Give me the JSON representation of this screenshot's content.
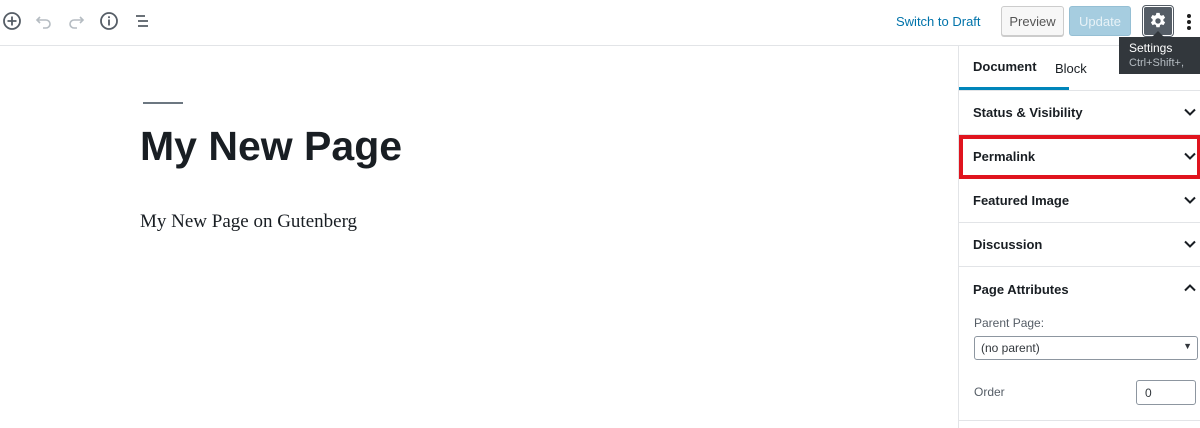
{
  "toolbar": {
    "icons": [
      "add-block-icon",
      "undo-icon",
      "redo-icon",
      "info-icon",
      "list-view-icon"
    ],
    "switch_to_draft": "Switch to Draft",
    "preview": "Preview",
    "update": "Update",
    "settings_icon": "gear-icon",
    "more_icon": "more-vertical-icon"
  },
  "tooltip": {
    "title": "Settings",
    "shortcut": "Ctrl+Shift+,"
  },
  "editor": {
    "title": "My New Page",
    "paragraph": "My New Page on Gutenberg"
  },
  "sidebar": {
    "tabs": [
      {
        "label": "Document",
        "active": true
      },
      {
        "label": "Block",
        "active": false
      }
    ],
    "panels": [
      {
        "label": "Status & Visibility",
        "expanded": false
      },
      {
        "label": "Permalink",
        "expanded": false,
        "highlighted": true
      },
      {
        "label": "Featured Image",
        "expanded": false
      },
      {
        "label": "Discussion",
        "expanded": false
      },
      {
        "label": "Page Attributes",
        "expanded": true
      }
    ],
    "page_attributes": {
      "parent_label": "Parent Page:",
      "parent_value": "(no parent)",
      "order_label": "Order",
      "order_value": "0"
    }
  },
  "colors": {
    "accent": "#0085ba",
    "link": "#0073aa",
    "highlight": "#e0141e",
    "settings_button": "#555d66"
  }
}
